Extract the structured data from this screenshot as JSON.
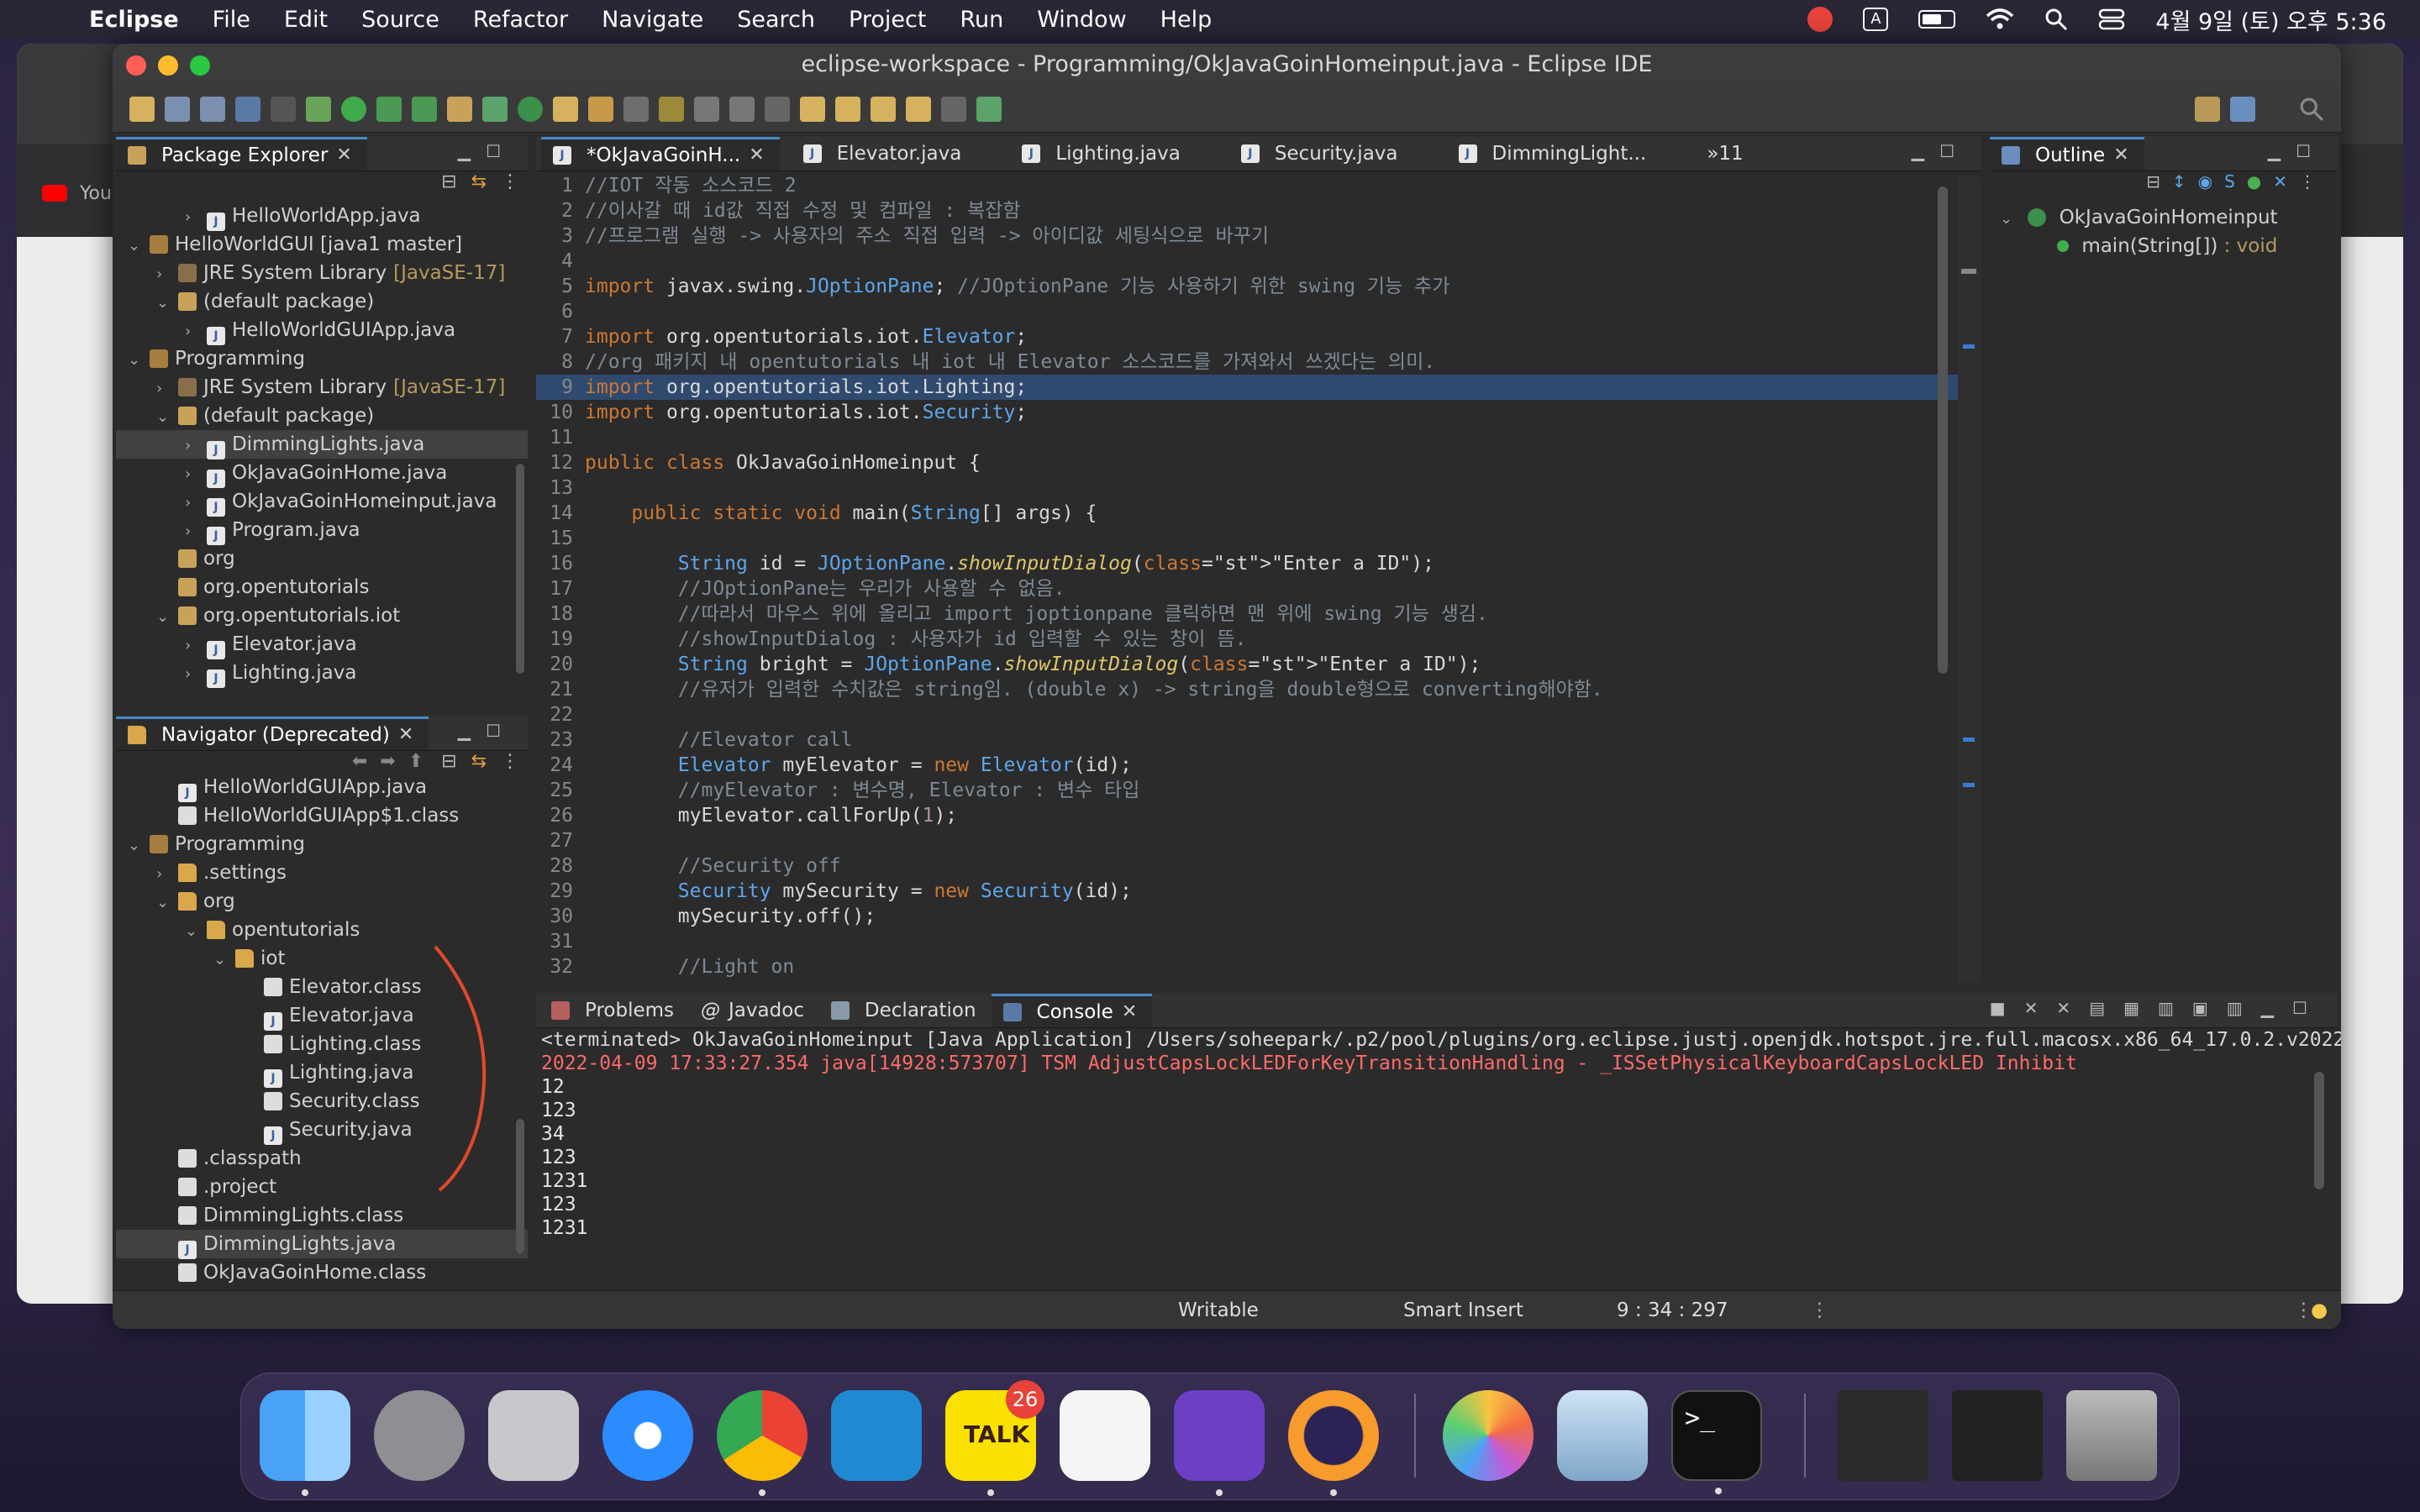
{
  "menubar": {
    "app": "Eclipse",
    "items": [
      "File",
      "Edit",
      "Source",
      "Refactor",
      "Navigate",
      "Search",
      "Project",
      "Run",
      "Window",
      "Help"
    ],
    "input_indicator": "A",
    "clock": "4월 9일 (토) 오후 5:36"
  },
  "window": {
    "title": "eclipse-workspace - Programming/OkJavaGoinHomeinput.java - Eclipse IDE"
  },
  "background_browser": {
    "tab_text": "You"
  },
  "package_explorer": {
    "title": "Package Explorer",
    "rows": [
      {
        "indent": 2,
        "arrow": "›",
        "icon": "j",
        "text": "HelloWorldApp.java"
      },
      {
        "indent": 0,
        "arrow": "⌄",
        "icon": "prj",
        "text": "HelloWorldGUI [java1 master]"
      },
      {
        "indent": 1,
        "arrow": "›",
        "icon": "lib",
        "text": "JRE System Library",
        "dim": "[JavaSE-17]"
      },
      {
        "indent": 1,
        "arrow": "⌄",
        "icon": "pkg",
        "text": "(default package)"
      },
      {
        "indent": 2,
        "arrow": "›",
        "icon": "j",
        "text": "HelloWorldGUIApp.java"
      },
      {
        "indent": 0,
        "arrow": "⌄",
        "icon": "prj",
        "text": "Programming"
      },
      {
        "indent": 1,
        "arrow": "›",
        "icon": "lib",
        "text": "JRE System Library",
        "dim": "[JavaSE-17]"
      },
      {
        "indent": 1,
        "arrow": "⌄",
        "icon": "pkg",
        "text": "(default package)"
      },
      {
        "indent": 2,
        "arrow": "›",
        "icon": "j",
        "text": "DimmingLights.java",
        "selected": true
      },
      {
        "indent": 2,
        "arrow": "›",
        "icon": "j",
        "text": "OkJavaGoinHome.java"
      },
      {
        "indent": 2,
        "arrow": "›",
        "icon": "j",
        "text": "OkJavaGoinHomeinput.java"
      },
      {
        "indent": 2,
        "arrow": "›",
        "icon": "j",
        "text": "Program.java"
      },
      {
        "indent": 1,
        "arrow": "",
        "icon": "pkg",
        "text": "org"
      },
      {
        "indent": 1,
        "arrow": "",
        "icon": "pkg",
        "text": "org.opentutorials"
      },
      {
        "indent": 1,
        "arrow": "⌄",
        "icon": "pkg",
        "text": "org.opentutorials.iot"
      },
      {
        "indent": 2,
        "arrow": "›",
        "icon": "j",
        "text": "Elevator.java"
      },
      {
        "indent": 2,
        "arrow": "›",
        "icon": "j",
        "text": "Lighting.java"
      }
    ]
  },
  "navigator": {
    "title": "Navigator (Deprecated)",
    "rows": [
      {
        "indent": 1,
        "arrow": "",
        "icon": "j",
        "text": "HelloWorldGUIApp.java"
      },
      {
        "indent": 1,
        "arrow": "",
        "icon": "cls",
        "text": "HelloWorldGUIApp$1.class"
      },
      {
        "indent": 0,
        "arrow": "⌄",
        "icon": "prj",
        "text": "Programming"
      },
      {
        "indent": 1,
        "arrow": "›",
        "icon": "fld",
        "text": ".settings"
      },
      {
        "indent": 1,
        "arrow": "⌄",
        "icon": "fld",
        "text": "org"
      },
      {
        "indent": 2,
        "arrow": "⌄",
        "icon": "fld",
        "text": "opentutorials"
      },
      {
        "indent": 3,
        "arrow": "⌄",
        "icon": "fld",
        "text": "iot"
      },
      {
        "indent": 4,
        "arrow": "",
        "icon": "cls",
        "text": "Elevator.class"
      },
      {
        "indent": 4,
        "arrow": "",
        "icon": "j",
        "text": "Elevator.java"
      },
      {
        "indent": 4,
        "arrow": "",
        "icon": "cls",
        "text": "Lighting.class"
      },
      {
        "indent": 4,
        "arrow": "",
        "icon": "j",
        "text": "Lighting.java"
      },
      {
        "indent": 4,
        "arrow": "",
        "icon": "cls",
        "text": "Security.class"
      },
      {
        "indent": 4,
        "arrow": "",
        "icon": "j",
        "text": "Security.java"
      },
      {
        "indent": 1,
        "arrow": "",
        "icon": "cls",
        "text": ".classpath"
      },
      {
        "indent": 1,
        "arrow": "",
        "icon": "cls",
        "text": ".project"
      },
      {
        "indent": 1,
        "arrow": "",
        "icon": "cls",
        "text": "DimmingLights.class"
      },
      {
        "indent": 1,
        "arrow": "",
        "icon": "j",
        "text": "DimmingLights.java",
        "selected": true
      },
      {
        "indent": 1,
        "arrow": "",
        "icon": "cls",
        "text": "OkJavaGoinHome.class"
      }
    ]
  },
  "editor_tabs": {
    "items": [
      "*OkJavaGoinH...",
      "Elevator.java",
      "Lighting.java",
      "Security.java",
      "DimmingLight..."
    ],
    "overflow": "»11"
  },
  "editor": {
    "lines": [
      "//IOT 작동 소스코드 2",
      "//이사갈 때 id값 직접 수정 및 컴파일 : 복잡함",
      "//프로그램 실행 -> 사용자의 주소 직접 입력 -> 아이디값 세팅식으로 바꾸기",
      "",
      "import javax.swing.JOptionPane; //JOptionPane 기능 사용하기 위한 swing 기능 추가",
      "",
      "import org.opentutorials.iot.Elevator;",
      "//org 패키지 내 opentutorials 내 iot 내 Elevator 소스코드를 가져와서 쓰겠다는 의미.",
      "import org.opentutorials.iot.Lighting;",
      "import org.opentutorials.iot.Security;",
      "",
      "public class OkJavaGoinHomeinput {",
      "",
      "    public static void main(String[] args) {",
      "",
      "        String id = JOptionPane.showInputDialog(\"Enter a ID\");",
      "        //JOptionPane는 우리가 사용할 수 없음.",
      "        //따라서 마우스 위에 올리고 import joptionpane 클릭하면 맨 위에 swing 기능 생김.",
      "        //showInputDialog : 사용자가 id 입력할 수 있는 창이 뜸.",
      "        String bright = JOptionPane.showInputDialog(\"Enter a ID\");",
      "        //유저가 입력한 수치값은 string임. (double x) -> string을 double형으로 converting해야함.",
      "",
      "        //Elevator call",
      "        Elevator myElevator = new Elevator(id);",
      "        //myElevator : 변수명, Elevator : 변수 타입",
      "        myElevator.callForUp(1);",
      "",
      "        //Security off",
      "        Security mySecurity = new Security(id);",
      "        mySecurity.off();",
      "",
      "        //Light on"
    ]
  },
  "outline": {
    "title": "Outline",
    "class_name": "OkJavaGoinHomeinput",
    "method": "main(String[])",
    "method_type": ": void"
  },
  "console_tabs": {
    "items": [
      "Problems",
      "Javadoc",
      "Declaration",
      "Console"
    ]
  },
  "console": {
    "header": "<terminated> OkJavaGoinHomeinput [Java Application] /Users/soheepark/.p2/pool/plugins/org.eclipse.justj.openjdk.hotspot.jre.full.macosx.x86_64_17.0.2.v20220201-1208/jre/bin/java  (2022. 4. 9. 오후 5:3",
    "error_line": "2022-04-09 17:33:27.354 java[14928:573707] TSM AdjustCapsLockLEDForKeyTransitionHandling - _ISSetPhysicalKeyboardCapsLockLED Inhibit",
    "output": [
      "12",
      "123",
      "34",
      "123",
      "1231",
      "123",
      "1231"
    ]
  },
  "status": {
    "writable": "Writable",
    "insert_mode": "Smart Insert",
    "position": "9 : 34 : 297"
  },
  "dock": {
    "kakao_badge": "26",
    "kakao_label": "TALK"
  },
  "colors": {
    "accent": "#4a88c7",
    "annotation": "#e2492b"
  }
}
